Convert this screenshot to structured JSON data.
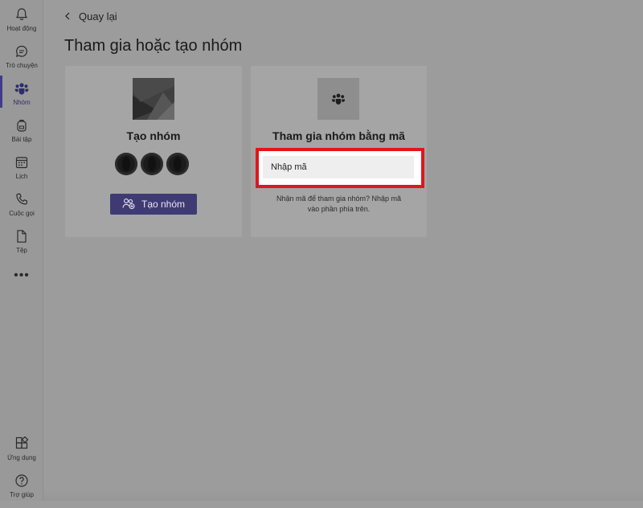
{
  "rail": {
    "items": [
      {
        "label": "Hoạt động",
        "icon": "bell-icon"
      },
      {
        "label": "Trò chuyện",
        "icon": "chat-icon"
      },
      {
        "label": "Nhóm",
        "icon": "teams-icon"
      },
      {
        "label": "Bài tập",
        "icon": "backpack-icon"
      },
      {
        "label": "Lịch",
        "icon": "calendar-icon"
      },
      {
        "label": "Cuộc gọi",
        "icon": "phone-icon"
      },
      {
        "label": "Tệp",
        "icon": "file-icon"
      }
    ],
    "more": "•••",
    "bottom_items": [
      {
        "label": "Ứng dụng",
        "icon": "apps-icon"
      },
      {
        "label": "Trợ giúp",
        "icon": "help-icon"
      }
    ]
  },
  "header": {
    "back_label": "Quay lại",
    "title": "Tham gia hoặc tạo nhóm"
  },
  "create_card": {
    "title": "Tạo nhóm",
    "button_label": "Tạo nhóm"
  },
  "join_card": {
    "title": "Tham gia nhóm bằng mã",
    "input_placeholder": "Nhập mã",
    "helper_line1": "Nhận mã để tham gia nhóm? Nhập mã",
    "helper_line2": "vào phần phía trên."
  },
  "colors": {
    "accent": "#3e3b74",
    "highlight": "#e0161e",
    "overlay": "#9c9c9c"
  }
}
